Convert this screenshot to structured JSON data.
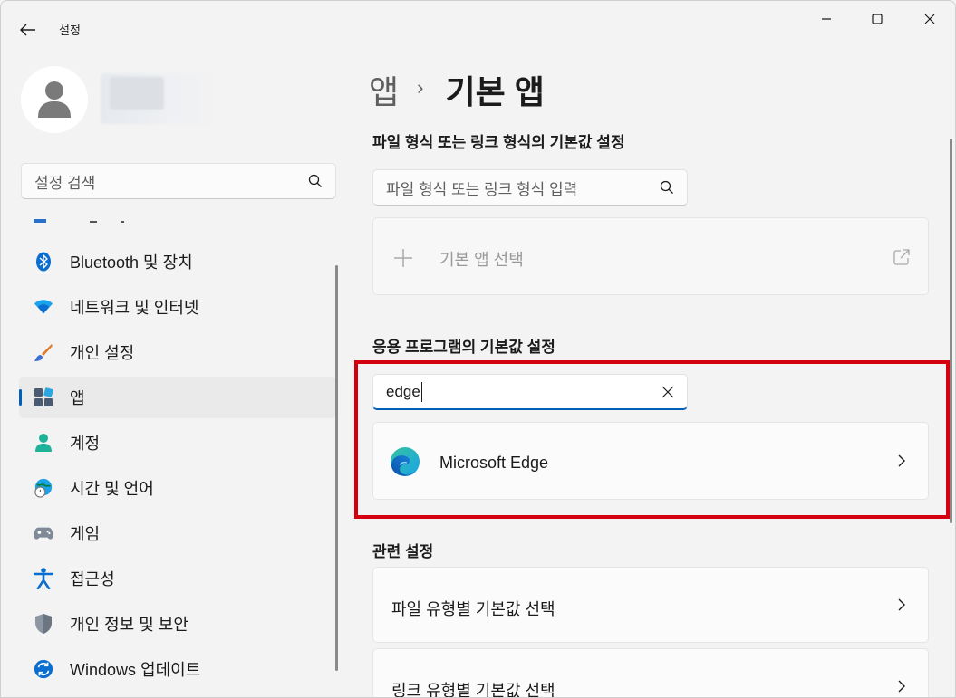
{
  "window": {
    "title": "설정",
    "icons": {
      "back": "back-arrow-icon",
      "minimize": "minimize-icon",
      "maximize": "maximize-icon",
      "close": "close-icon"
    }
  },
  "sidebar": {
    "search_placeholder": "설정 검색",
    "search_icon": "search-icon",
    "items": [
      {
        "label": "Bluetooth 및 장치",
        "icon": "bluetooth-icon"
      },
      {
        "label": "네트워크 및 인터넷",
        "icon": "wifi-icon"
      },
      {
        "label": "개인 설정",
        "icon": "paintbrush-icon"
      },
      {
        "label": "앱",
        "icon": "apps-icon",
        "selected": true
      },
      {
        "label": "계정",
        "icon": "account-icon"
      },
      {
        "label": "시간 및 언어",
        "icon": "globe-clock-icon"
      },
      {
        "label": "게임",
        "icon": "gamepad-icon"
      },
      {
        "label": "접근성",
        "icon": "accessibility-icon"
      },
      {
        "label": "개인 정보 및 보안",
        "icon": "shield-icon"
      },
      {
        "label": "Windows 업데이트",
        "icon": "update-icon"
      }
    ]
  },
  "main": {
    "breadcrumb": {
      "parent": "앱",
      "separator": "›",
      "current": "기본 앱"
    },
    "file_link_section": {
      "title": "파일 형식 또는 링크 형식의 기본값 설정",
      "search_placeholder": "파일 형식 또는 링크 형식 입력",
      "choose_default_label": "기본 앱 선택"
    },
    "apps_section": {
      "title": "응용 프로그램의 기본값 설정",
      "search_value": "edge",
      "result_label": "Microsoft Edge"
    },
    "related_section": {
      "title": "관련 설정",
      "items": [
        {
          "label": "파일 유형별 기본값 선택"
        },
        {
          "label": "링크 유형별 기본값 선택"
        }
      ]
    }
  },
  "colors": {
    "accent": "#005fb8",
    "highlight_border": "#d4000f",
    "background": "#f3f3f3",
    "card": "#fbfbfb"
  }
}
